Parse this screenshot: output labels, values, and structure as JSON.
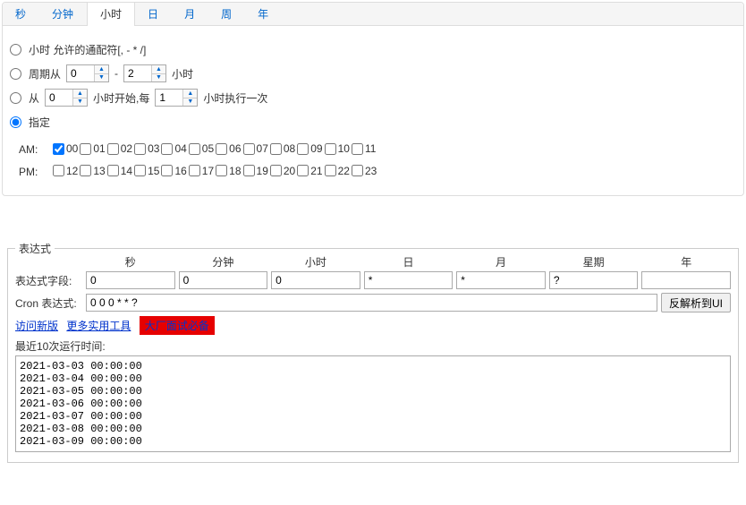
{
  "tabs": [
    "秒",
    "分钟",
    "小时",
    "日",
    "月",
    "周",
    "年"
  ],
  "active_tab_index": 2,
  "options": {
    "opt0": "小时 允许的通配符[, - * /]",
    "opt1_prefix": "周期从",
    "opt1_from": "0",
    "opt1_to": "2",
    "opt1_suffix": "小时",
    "opt2_prefix": "从",
    "opt2_start": "0",
    "opt2_mid": "小时开始,每",
    "opt2_every": "1",
    "opt2_suffix": "小时执行一次",
    "opt3": "指定",
    "selected": 3
  },
  "am_label": "AM:",
  "pm_label": "PM:",
  "am_hours": [
    "00",
    "01",
    "02",
    "03",
    "04",
    "05",
    "06",
    "07",
    "08",
    "09",
    "10",
    "11"
  ],
  "pm_hours": [
    "12",
    "13",
    "14",
    "15",
    "16",
    "17",
    "18",
    "19",
    "20",
    "21",
    "22",
    "23"
  ],
  "am_checked_index": 0,
  "fieldset_legend": "表达式",
  "headers": [
    "",
    "秒",
    "分钟",
    "小时",
    "日",
    "月",
    "星期",
    "年"
  ],
  "expr_label": "表达式字段:",
  "expr_values": [
    "0",
    "0",
    "0",
    "*",
    "*",
    "?",
    ""
  ],
  "cron_label": "Cron 表达式:",
  "cron_value": "0 0 0 * * ?",
  "reverse_btn": "反解析到UI",
  "links": {
    "new_version": "访问新版",
    "more_tools": "更多实用工具",
    "red_tag": "大厂面试必备"
  },
  "recent_label": "最近10次运行时间:",
  "runtimes": "2021-03-03 00:00:00\n2021-03-04 00:00:00\n2021-03-05 00:00:00\n2021-03-06 00:00:00\n2021-03-07 00:00:00\n2021-03-08 00:00:00\n2021-03-09 00:00:00"
}
